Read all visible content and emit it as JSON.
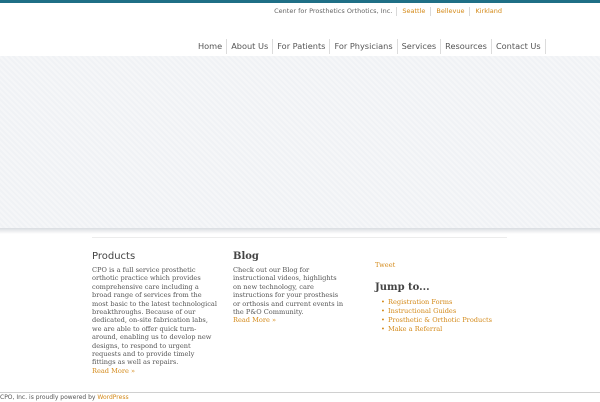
{
  "utility": {
    "company": "Center for Prosthetics Orthotics, Inc.",
    "locations": [
      "Seattle",
      "Bellevue",
      "Kirkland"
    ]
  },
  "nav": {
    "items": [
      "Home",
      "About Us",
      "For Patients",
      "For Physicians",
      "Services",
      "Resources",
      "Contact Us"
    ]
  },
  "products": {
    "heading": "Products",
    "body": "CPO is a full service prosthetic orthotic practice which provides comprehensive care including a broad range of services from the most basic to the latest technological breakthroughs. Because of our dedicated, on-site fabrication labs, we are able to offer quick turn-around, enabling us to develop new designs, to respond to urgent requests and to provide timely fittings as well as repairs.",
    "more": "Read More »"
  },
  "blog": {
    "heading": "Blog",
    "body": "Check out our Blog for instructional videos, highlights on new technology, care instructions for your prosthesis or orthosis and current events in the P&O Community.",
    "more": "Read More »"
  },
  "sidebar": {
    "tweet": "Tweet",
    "jump_heading": "Jump to...",
    "links": [
      "Registration Forms",
      "Instructional Guides",
      "Prosthetic & Orthotic Products",
      "Make a Referral"
    ]
  },
  "footer": {
    "text": "CPO, Inc. is proudly powered by ",
    "link": "WordPress"
  },
  "colors": {
    "accent": "#d48a1a",
    "topbar": "#1f6f86"
  }
}
